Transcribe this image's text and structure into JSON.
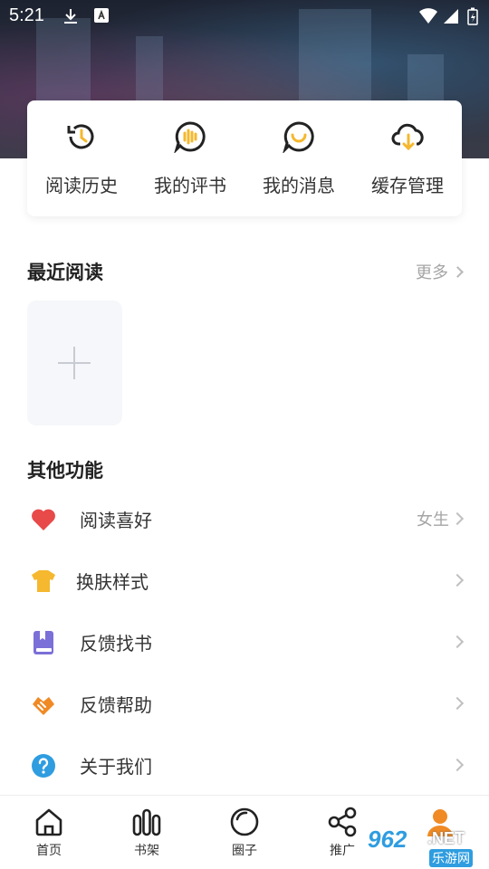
{
  "status_bar": {
    "time": "5:21"
  },
  "shortcuts": [
    {
      "label": "阅读历史",
      "icon": "history-icon"
    },
    {
      "label": "我的评书",
      "icon": "audio-comment-icon"
    },
    {
      "label": "我的消息",
      "icon": "message-icon"
    },
    {
      "label": "缓存管理",
      "icon": "cloud-download-icon"
    }
  ],
  "recent": {
    "title": "最近阅读",
    "more": "更多"
  },
  "other": {
    "title": "其他功能",
    "items": [
      {
        "label": "阅读喜好",
        "value": "女生",
        "icon": "heart-icon",
        "color": "#e84a4a"
      },
      {
        "label": "换肤样式",
        "value": "",
        "icon": "tshirt-icon",
        "color": "#f5b82e"
      },
      {
        "label": "反馈找书",
        "value": "",
        "icon": "book-icon",
        "color": "#7b6fd8"
      },
      {
        "label": "反馈帮助",
        "value": "",
        "icon": "handshake-icon",
        "color": "#f08a24"
      },
      {
        "label": "关于我们",
        "value": "",
        "icon": "question-icon",
        "color": "#2f9de0"
      }
    ]
  },
  "nav": [
    {
      "label": "首页",
      "icon": "home-icon"
    },
    {
      "label": "书架",
      "icon": "bookshelf-icon"
    },
    {
      "label": "圈子",
      "icon": "circle-icon"
    },
    {
      "label": "推广",
      "icon": "share-icon"
    },
    {
      "label": "",
      "icon": "profile-icon"
    }
  ],
  "watermark": {
    "number": "962",
    "suffix": ".NET",
    "text": "乐游网"
  }
}
